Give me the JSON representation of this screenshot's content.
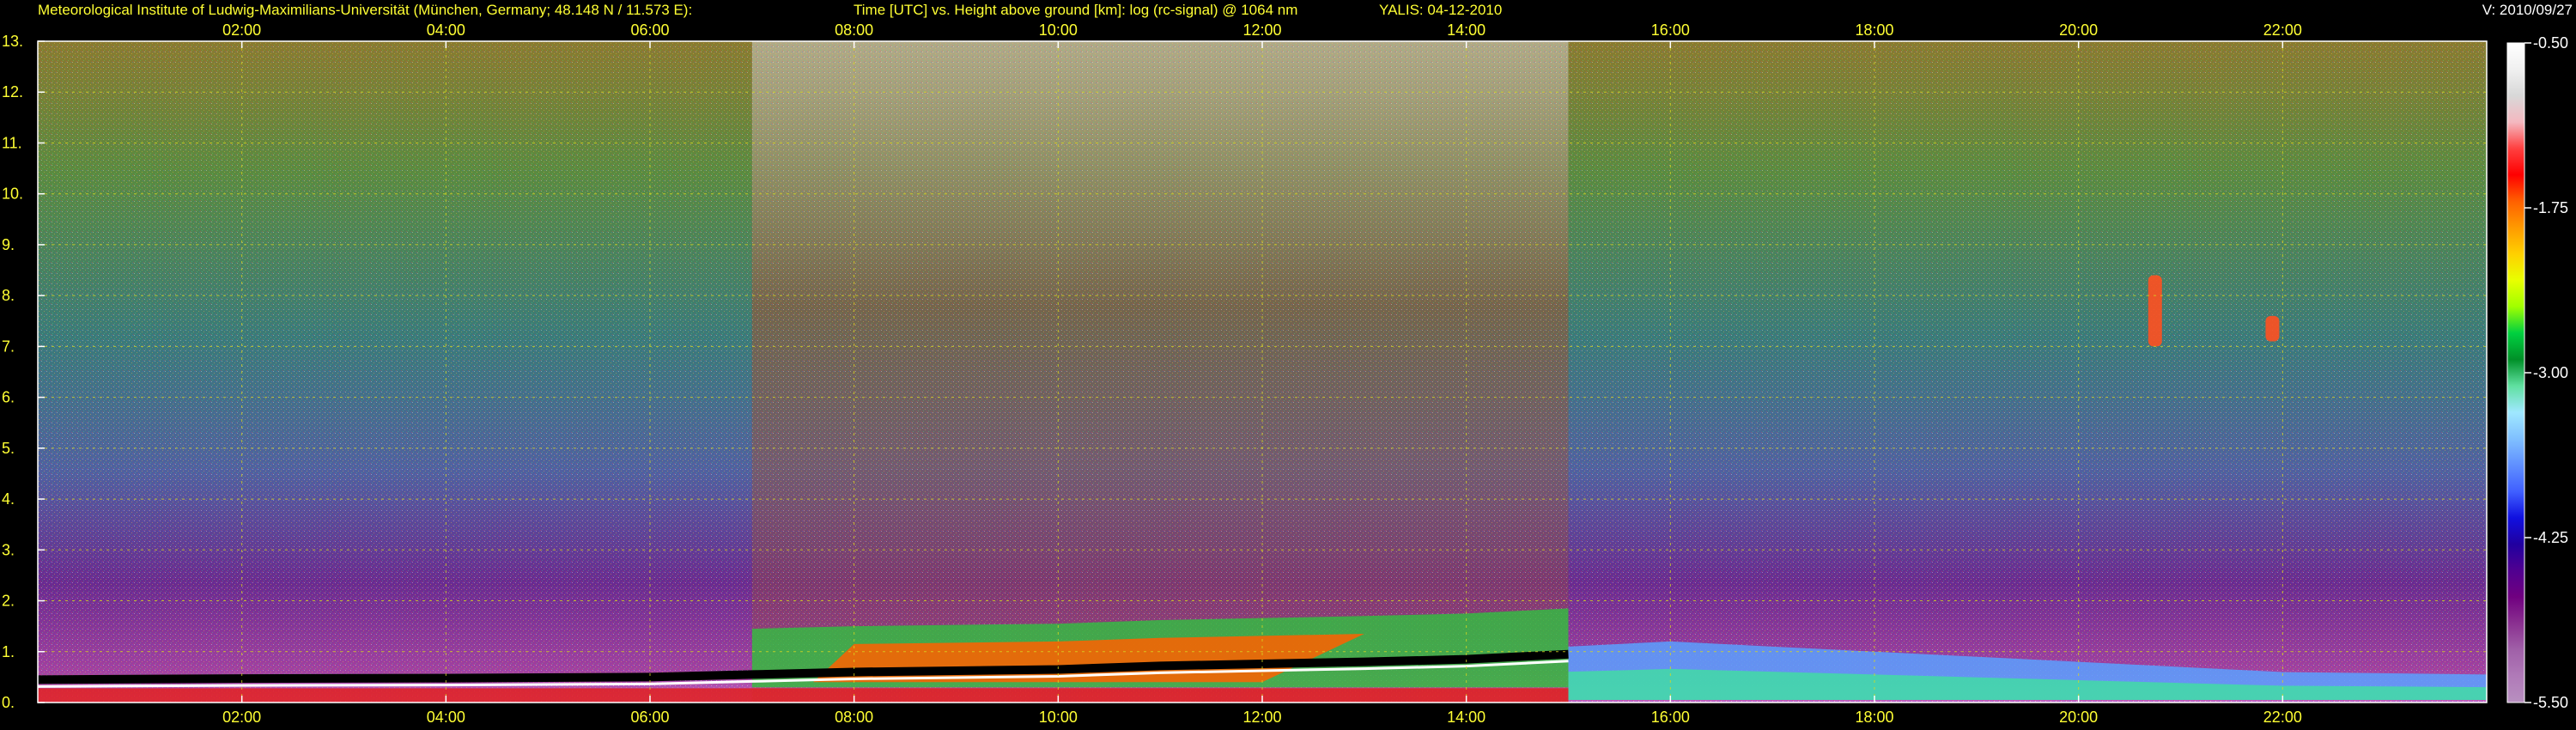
{
  "header": {
    "institute": "Meteorological Institute of Ludwig-Maximilians-Universität (München, Germany; 48.148 N / 11.573 E):",
    "axis_description": "Time [UTC] vs. Height above ground [km]: log (rc-signal) @ 1064 nm",
    "station_date": "YALIS: 04-12-2010",
    "version": "V: 2010/09/27"
  },
  "colors": {
    "header_text": "#ffff33",
    "version_text": "#ffffff",
    "background": "#000000",
    "grid": "#d8d820"
  },
  "chart_data": {
    "type": "heatmap",
    "title": "Time [UTC] vs. Height above ground [km]: log (rc-signal) @ 1064 nm",
    "x_tick_labels": [
      "02:00",
      "04:00",
      "06:00",
      "08:00",
      "10:00",
      "12:00",
      "14:00",
      "16:00",
      "18:00",
      "20:00",
      "22:00"
    ],
    "x_ticks_hours": [
      2,
      4,
      6,
      8,
      10,
      12,
      14,
      16,
      18,
      20,
      22
    ],
    "xlim_hours": [
      0,
      24
    ],
    "y_tick_labels": [
      "0.",
      "1.",
      "2.",
      "3.",
      "4.",
      "5.",
      "6.",
      "7.",
      "8.",
      "9.",
      "10.",
      "11.",
      "12.",
      "13."
    ],
    "y_ticks_km": [
      0,
      1,
      2,
      3,
      4,
      5,
      6,
      7,
      8,
      9,
      10,
      11,
      12,
      13
    ],
    "ylim_km": [
      0,
      13
    ],
    "grid": true,
    "colorbar": {
      "labels": [
        "-0.50",
        "-1.75",
        "-3.00",
        "-4.25",
        "-5.50"
      ],
      "values": [
        -0.5,
        -1.75,
        -3.0,
        -4.25,
        -5.5
      ],
      "range": [
        -5.5,
        -0.5
      ],
      "colors_top_to_bottom": [
        "#ffffff",
        "#f0f0f0",
        "#d8d8d8",
        "#f4b8c0",
        "#ff4040",
        "#ff0000",
        "#ff6000",
        "#ff9a00",
        "#ffd000",
        "#e8ff00",
        "#a0ff00",
        "#00d040",
        "#009028",
        "#60e0a0",
        "#a0e8ff",
        "#80c0ff",
        "#6090ff",
        "#4060ff",
        "#1010e0",
        "#2000a0",
        "#500090",
        "#700080",
        "#8a3090",
        "#a060a8",
        "#b07ab8",
        "#b890c0"
      ]
    },
    "features": {
      "boundary_layer_top_km": [
        {
          "t": 0.0,
          "h": 0.45
        },
        {
          "t": 2.0,
          "h": 0.47
        },
        {
          "t": 4.0,
          "h": 0.48
        },
        {
          "t": 6.0,
          "h": 0.5
        },
        {
          "t": 7.0,
          "h": 0.55
        },
        {
          "t": 8.0,
          "h": 0.6
        },
        {
          "t": 10.0,
          "h": 0.65
        },
        {
          "t": 11.0,
          "h": 0.72
        },
        {
          "t": 12.0,
          "h": 0.76
        },
        {
          "t": 13.0,
          "h": 0.8
        },
        {
          "t": 14.0,
          "h": 0.85
        },
        {
          "t": 15.0,
          "h": 0.95
        }
      ],
      "evening_aerosol_layer_km": [
        {
          "t": 15.0,
          "h": 1.1
        },
        {
          "t": 16.0,
          "h": 1.2
        },
        {
          "t": 18.0,
          "h": 1.0
        },
        {
          "t": 20.0,
          "h": 0.8
        },
        {
          "t": 22.0,
          "h": 0.6
        },
        {
          "t": 24.0,
          "h": 0.55
        }
      ],
      "isolated_clouds": [
        {
          "t": 20.75,
          "h_min": 7.0,
          "h_max": 8.4
        },
        {
          "t": 21.9,
          "h_min": 7.1,
          "h_max": 7.6
        }
      ],
      "high_noise_daytime_hours": [
        7.0,
        15.0
      ]
    }
  }
}
